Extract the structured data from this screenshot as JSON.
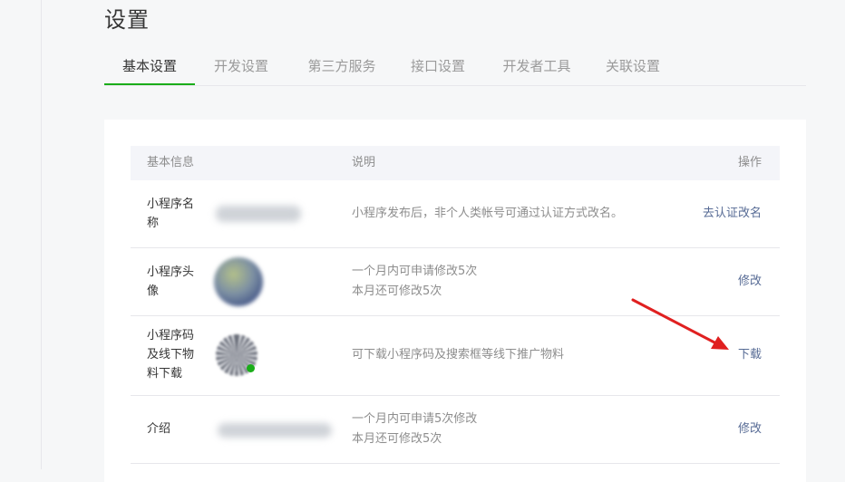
{
  "page": {
    "title": "设置"
  },
  "tabs": [
    {
      "label": "基本设置",
      "active": true
    },
    {
      "label": "开发设置",
      "active": false
    },
    {
      "label": "第三方服务",
      "active": false
    },
    {
      "label": "接口设置",
      "active": false
    },
    {
      "label": "开发者工具",
      "active": false
    },
    {
      "label": "关联设置",
      "active": false
    }
  ],
  "table": {
    "headers": {
      "info": "基本信息",
      "desc": "说明",
      "action": "操作"
    },
    "rows": [
      {
        "label": "小程序名称",
        "desc_line1": "小程序发布后，非个人类帐号可通过认证方式改名。",
        "desc_line2": "",
        "action": "去认证改名"
      },
      {
        "label": "小程序头像",
        "desc_line1": "一个月内可申请修改5次",
        "desc_line2": "本月还可修改5次",
        "action": "修改"
      },
      {
        "label": "小程序码及线下物料下载",
        "desc_line1": "可下载小程序码及搜索框等线下推广物料",
        "desc_line2": "",
        "action": "下载"
      },
      {
        "label": "介绍",
        "desc_line1": "一个月内可申请5次修改",
        "desc_line2": "本月还可修改5次",
        "action": "修改"
      }
    ]
  },
  "colors": {
    "accent_tab": "#1aad19",
    "link": "#576b95",
    "annotation_arrow": "#e02020"
  },
  "icons": {
    "avatar": "avatar-image",
    "qr": "mini-program-code-icon"
  }
}
